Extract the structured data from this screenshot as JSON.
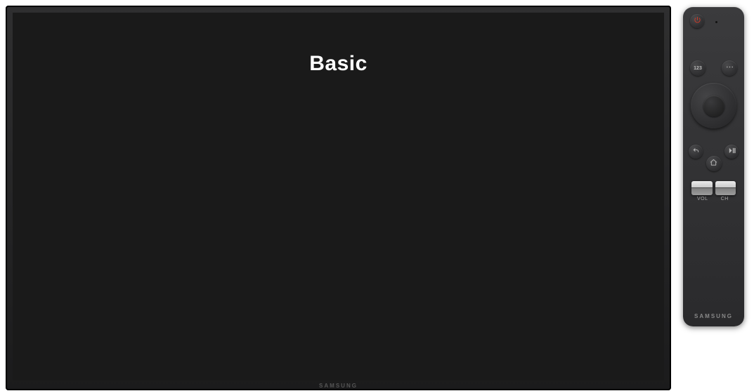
{
  "tv": {
    "title": "Basic",
    "brand": "SAMSUNG"
  },
  "remote": {
    "brand": "SAMSUNG",
    "buttons": {
      "power": "power",
      "numpad": "123",
      "more": "•••",
      "back": "back",
      "home": "home",
      "playpause": "play-pause"
    },
    "rockers": {
      "volume_label": "VOL",
      "channel_label": "CH"
    }
  }
}
